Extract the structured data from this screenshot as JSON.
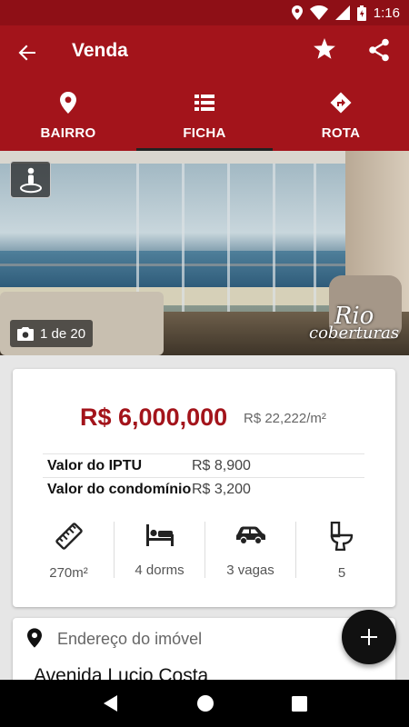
{
  "status_bar": {
    "time": "1:16",
    "icons": [
      "location-icon",
      "wifi-icon",
      "signal-icon",
      "battery-icon"
    ]
  },
  "app_bar": {
    "title": "Venda",
    "icons": [
      "back-arrow-icon",
      "star-icon",
      "share-icon"
    ]
  },
  "tabs": [
    {
      "label": "BAIRRO",
      "icon": "place-icon"
    },
    {
      "label": "FICHA",
      "icon": "list-icon",
      "active": true
    },
    {
      "label": "ROTA",
      "icon": "directions-icon"
    }
  ],
  "photo": {
    "counter": "1 de 20",
    "watermark_line1": "Rio",
    "watermark_line2": "coberturas"
  },
  "listing": {
    "price": "R$ 6,000,000",
    "price_per_m2": "R$ 22,222/m²",
    "fees": [
      {
        "label": "Valor do IPTU",
        "value": "R$ 8,900"
      },
      {
        "label": "Valor do condomínio",
        "value": "R$ 3,200"
      }
    ],
    "features": [
      {
        "icon": "ruler-icon",
        "label": "270m²"
      },
      {
        "icon": "bed-icon",
        "label": "4 dorms"
      },
      {
        "icon": "car-icon",
        "label": "3 vagas"
      },
      {
        "icon": "toilet-icon",
        "label": "5"
      }
    ]
  },
  "address": {
    "label": "Endereço do imóvel",
    "value": "Avenida Lucio Costa"
  },
  "colors": {
    "primary": "#a3141b",
    "status_bar": "#8e0f16",
    "fab": "#111111"
  }
}
